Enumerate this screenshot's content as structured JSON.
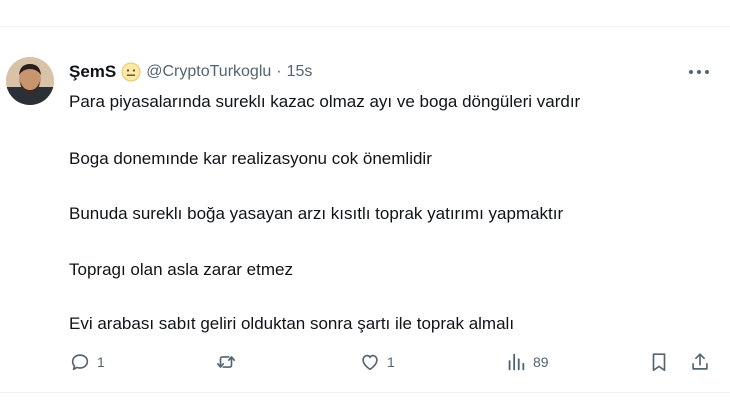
{
  "tweet": {
    "author": {
      "display_name": "ŞemS",
      "emoji": "neutral-face-emoji",
      "handle": "@CryptoTurkoglu",
      "time": "15s"
    },
    "lines": [
      "Para piyasalarında sureklı kazac olmaz ayı ve boga döngüleri vardır",
      "Boga donemınde kar realizasyonu cok önemlidir",
      "Bunuda sureklı boğa yasayan arzı kısıtlı toprak yatırımı yapmaktır",
      "Topragı olan asla zarar etmez",
      "Evi arabası sabıt geliri olduktan sonra şartı ile toprak almalı"
    ],
    "actions": {
      "replies": "1",
      "retweets": "",
      "likes": "1",
      "views": "89"
    }
  },
  "icons": {
    "reply": "reply-icon",
    "retweet": "retweet-icon",
    "like": "heart-icon",
    "views": "views-icon",
    "bookmark": "bookmark-icon",
    "share": "share-icon",
    "more": "more-icon"
  },
  "colors": {
    "text": "#0f1419",
    "secondary": "#536471",
    "divider": "#eff3f4"
  }
}
